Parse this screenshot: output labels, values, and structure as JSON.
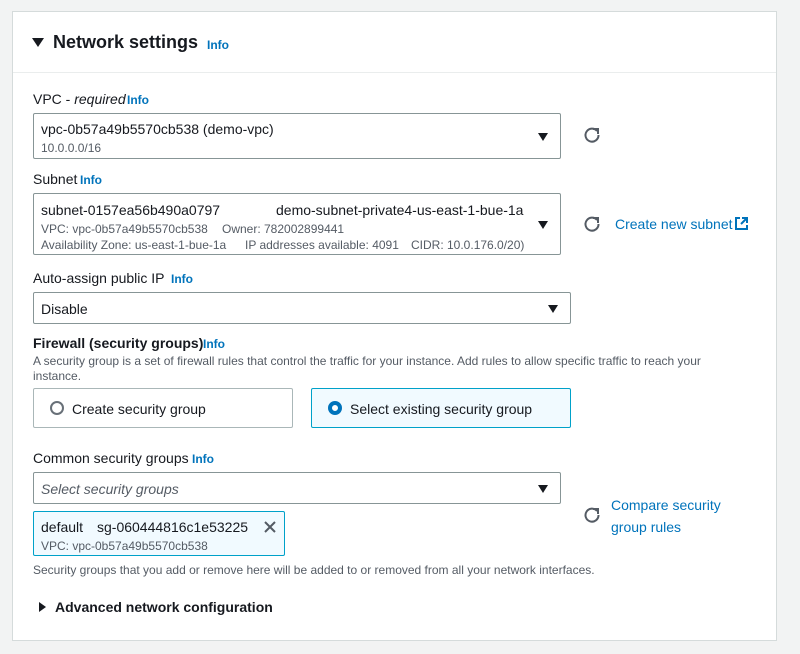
{
  "section": {
    "title": "Network settings",
    "info": "Info"
  },
  "vpc": {
    "label": "VPC - ",
    "required": "required",
    "info": "Info",
    "value": "vpc-0b57a49b5570cb538 (demo-vpc)",
    "sub": "10.0.0.0/16"
  },
  "subnet": {
    "label": "Subnet",
    "info": "Info",
    "id": "subnet-0157ea56b490a0797",
    "name": "demo-subnet-private4-us-east-1-bue-1a",
    "vpc": "VPC: vpc-0b57a49b5570cb538",
    "owner": "Owner: 782002899441",
    "az": "Availability Zone: us-east-1-bue-1a",
    "ips": "IP addresses available: 4091",
    "cidr": "CIDR: 10.0.176.0/20)",
    "create_link": "Create new subnet"
  },
  "public_ip": {
    "label": "Auto-assign public IP",
    "info": "Info",
    "value": "Disable"
  },
  "firewall": {
    "label": "Firewall (security groups)",
    "info": "Info",
    "description": "A security group is a set of firewall rules that control the traffic for your instance. Add rules to allow specific traffic to reach your instance.",
    "options": [
      {
        "label": "Create security group",
        "selected": false
      },
      {
        "label": "Select existing security group",
        "selected": true
      }
    ]
  },
  "common_sg": {
    "label": "Common security groups",
    "info": "Info",
    "placeholder": "Select security groups",
    "token": {
      "name": "default",
      "id": "sg-060444816c1e53225",
      "vpc": "VPC: vpc-0b57a49b5570cb538"
    },
    "compare_link_1": "Compare security",
    "compare_link_2": "group rules",
    "helper": "Security groups that you add or remove here will be added to or removed from all your network interfaces."
  },
  "advanced": {
    "label": "Advanced network configuration"
  },
  "colors": {
    "link": "#0073bb",
    "selected_border": "#00a1c9",
    "selected_bg": "#f1faff"
  }
}
